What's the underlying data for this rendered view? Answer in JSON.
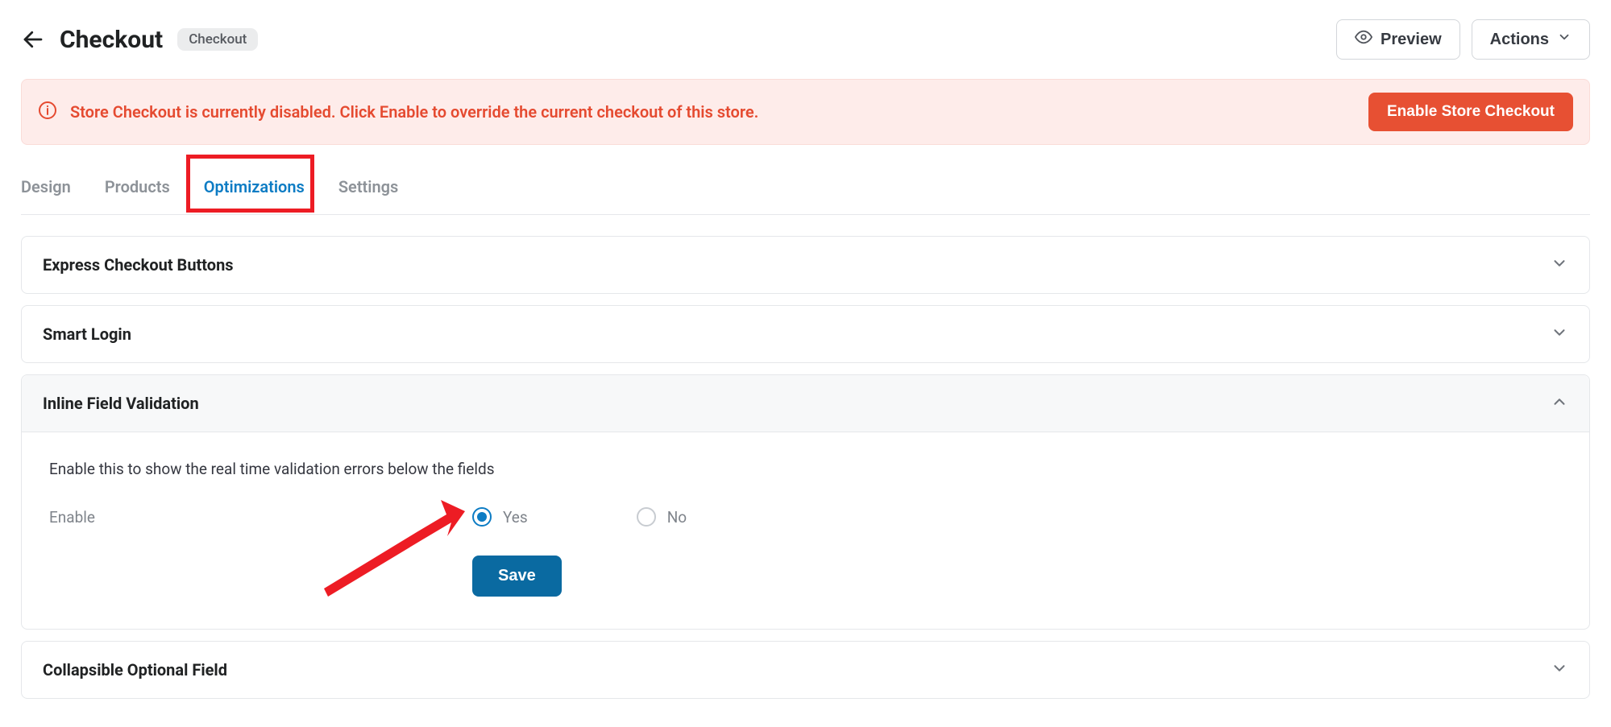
{
  "header": {
    "title": "Checkout",
    "badge": "Checkout",
    "preview_label": "Preview",
    "actions_label": "Actions"
  },
  "alert": {
    "message": "Store Checkout is currently disabled. Click Enable to override the current checkout of this store.",
    "cta_label": "Enable Store Checkout"
  },
  "tabs": {
    "design": "Design",
    "products": "Products",
    "optimizations": "Optimizations",
    "settings": "Settings"
  },
  "panels": {
    "express": {
      "title": "Express Checkout Buttons"
    },
    "smart_login": {
      "title": "Smart Login"
    },
    "inline_validation": {
      "title": "Inline Field Validation",
      "description": "Enable this to show the real time validation errors below the fields",
      "enable_label": "Enable",
      "option_yes": "Yes",
      "option_no": "No",
      "save_label": "Save"
    },
    "collapsible": {
      "title": "Collapsible Optional Field"
    }
  }
}
